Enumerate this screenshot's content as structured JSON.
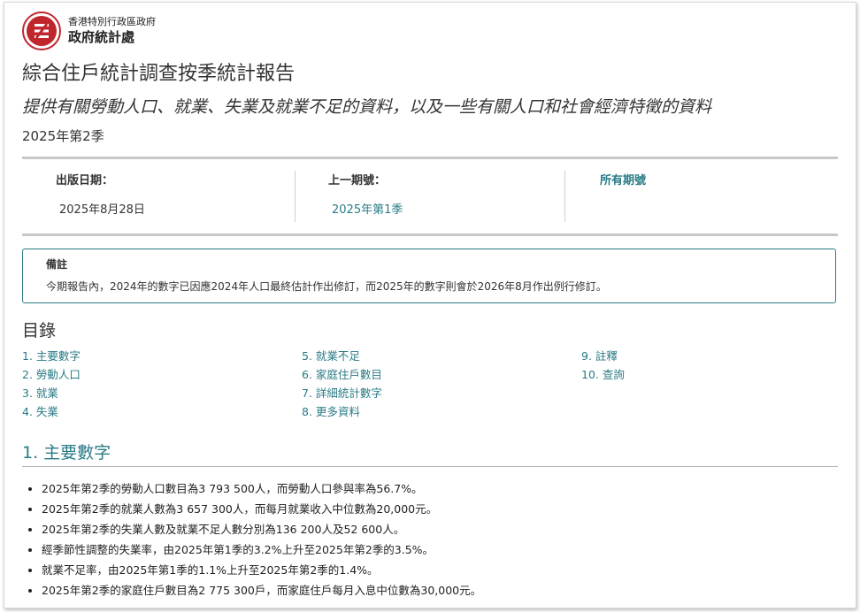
{
  "header": {
    "org_sub": "香港特別行政區政府",
    "org_main": "政府統計處"
  },
  "title": "綜合住戶統計調查按季統計報告",
  "subtitle": "提供有關勞動人口、就業、失業及就業不足的資料，以及一些有關人口和社會經濟特徵的資料",
  "period": "2025年第2季",
  "info": {
    "release_label": "出版日期：",
    "release_value": "2025年8月28日",
    "previous_label": "上一期號：",
    "previous_value": "2025年第1季",
    "all_issues": "所有期號"
  },
  "note": {
    "title": "備註",
    "text": "今期報告內，2024年的數字已因應2024年人口最終估計作出修訂，而2025年的數字則會於2026年8月作出例行修訂。"
  },
  "toc": {
    "title": "目錄",
    "col1": [
      "1. 主要數字",
      "2. 勞動人口",
      "3. 就業",
      "4. 失業"
    ],
    "col2": [
      "5. 就業不足",
      "6. 家庭住戶數目",
      "7. 詳細統計數字",
      "8. 更多資料"
    ],
    "col3": [
      "9. 註釋",
      "10. 查詢"
    ]
  },
  "section1": {
    "title": "1. 主要數字",
    "bullets": [
      "2025年第2季的勞動人口數目為3 793 500人，而勞動人口參與率為56.7%。",
      "2025年第2季的就業人數為3 657 300人，而每月就業收入中位數為20,000元。",
      "2025年第2季的失業人數及就業不足人數分別為136 200人及52 600人。",
      "經季節性調整的失業率，由2025年第1季的3.2%上升至2025年第2季的3.5%。",
      "就業不足率，由2025年第1季的1.1%上升至2025年第2季的1.4%。",
      "2025年第2季的家庭住戶數目為2 775 300戶，而家庭住戶每月入息中位數為30,000元。"
    ]
  },
  "colors": {
    "accent": "#2a7b86",
    "brand": "#c0272d",
    "rule": "#c8c8c8"
  }
}
